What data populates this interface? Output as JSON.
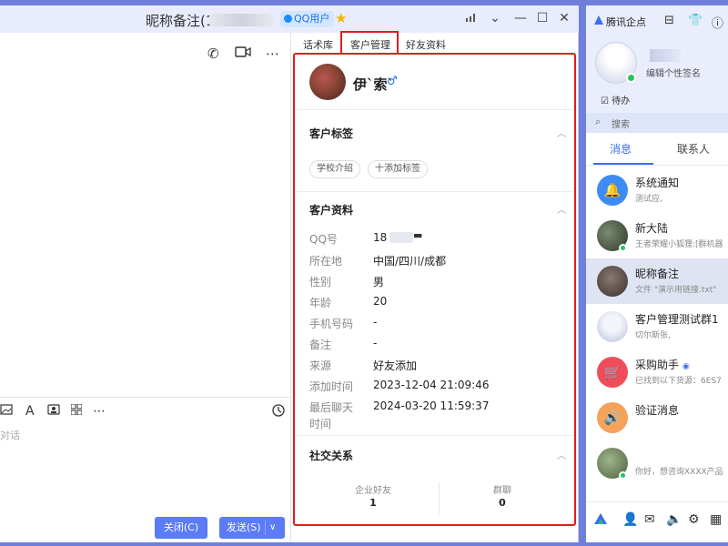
{
  "chat_window": {
    "title": "昵称备注(18",
    "qq_badge": "QQ用户",
    "tabs": [
      "话术库",
      "客户管理",
      "好友资料"
    ],
    "compose_hint": "对话",
    "close_label": "关闭(C)",
    "send_label": "发送(S)"
  },
  "customer": {
    "name": "伊`索`",
    "gender_symbol": "♂",
    "tags_section": "客户标签",
    "tags": [
      "学校介绍",
      "十添加标签"
    ],
    "profile_section": "客户资料",
    "fields": [
      {
        "key": "QQ号",
        "value": "18"
      },
      {
        "key": "所在地",
        "value": "中国/四川/成都"
      },
      {
        "key": "性别",
        "value": "男"
      },
      {
        "key": "年龄",
        "value": "20"
      },
      {
        "key": "手机号码",
        "value": "-"
      },
      {
        "key": "备注",
        "value": "-"
      },
      {
        "key": "来源",
        "value": "好友添加"
      },
      {
        "key": "添加时间",
        "value": "2023-12-04 21:09:46"
      },
      {
        "key": "最后聊天",
        "key2": "时间",
        "value": "2024-03-20 11:59:37"
      }
    ],
    "social_section": "社交关系",
    "stats": [
      {
        "label": "企业好友",
        "value": "1"
      },
      {
        "label": "群聊",
        "value": "0"
      }
    ]
  },
  "qq_main": {
    "brand": "腾讯企点",
    "signature": "编辑个性签名",
    "todo": "待办",
    "search_placeholder": "搜索",
    "tab_messages": "消息",
    "tab_contacts": "联系人",
    "conversations": [
      {
        "title": "系统通知",
        "subtitle": "测试应,",
        "avatar_color": "#3d8bf5",
        "icon": "bell-icon"
      },
      {
        "title": "新大陆",
        "subtitle": "王者荣耀小狐狸:[群机器",
        "avatar_color": "#4b5a46",
        "icon": "group-avatar"
      },
      {
        "title": "昵称备注",
        "subtitle": "文件 \"演示用链接.txt\"",
        "avatar_color": "#5b4a48",
        "icon": "user-avatar"
      },
      {
        "title": "客户管理测试群1",
        "subtitle": "切尔斯张,",
        "avatar_color": "#cfd6e6",
        "icon": "group-avatar"
      },
      {
        "title": "采购助手",
        "subtitle": "已找到以下货源：6ES7",
        "avatar_color": "#f04d5b",
        "icon": "shopping-icon"
      },
      {
        "title": "验证消息",
        "subtitle": "",
        "avatar_color": "#f5a25a",
        "icon": "speaker-icon"
      },
      {
        "title": "",
        "subtitle": "你好，想咨询XXXX产品",
        "avatar_color": "#6f8a5a",
        "icon": "user-avatar"
      }
    ]
  }
}
